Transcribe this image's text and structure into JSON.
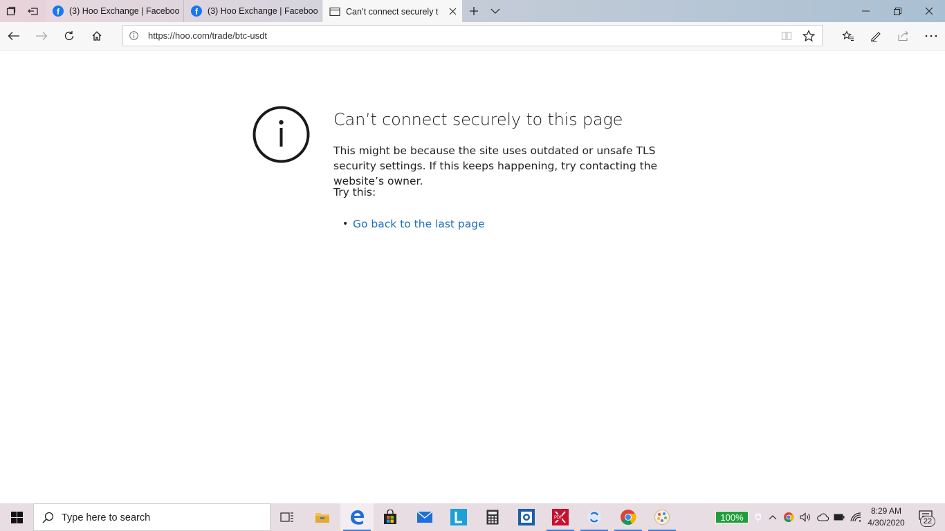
{
  "browser": {
    "tabs": [
      {
        "title": "(3) Hoo Exchange | Faceboo",
        "favicon": "facebook-icon",
        "active": false
      },
      {
        "title": "(3) Hoo Exchange | Faceboo",
        "favicon": "facebook-icon",
        "active": false
      },
      {
        "title": "Can’t connect securely t",
        "favicon": "page-icon",
        "active": true
      }
    ],
    "address": {
      "url": "https://hoo.com/trade/btc-usdt"
    }
  },
  "page": {
    "title": "Can’t connect securely to this page",
    "description": "This might be because the site uses outdated or unsafe TLS security settings. If this keeps happening, try contacting the website’s owner.",
    "try_label": "Try this:",
    "bullet": "•",
    "go_back_link": "Go back to the last page"
  },
  "taskbar": {
    "search_placeholder": "Type here to search",
    "battery": "100%",
    "time": "8:29 AM",
    "date": "4/30/2020",
    "notification_count": "22"
  },
  "colors": {
    "link": "#1f6fb8",
    "battery": "#1f9e3a",
    "accent": "#3a7bd5"
  }
}
